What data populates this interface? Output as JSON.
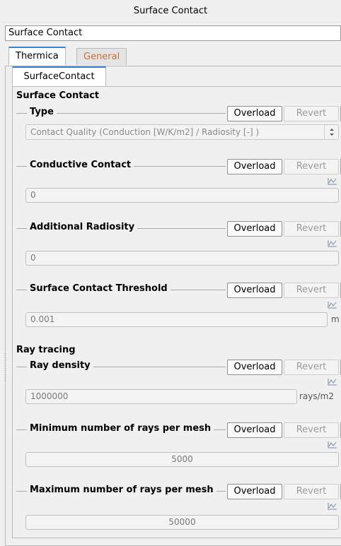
{
  "window": {
    "title": "Surface Contact"
  },
  "name_field": {
    "value": "Surface Contact"
  },
  "tabs": [
    {
      "label": "Thermica"
    },
    {
      "label": "General"
    }
  ],
  "subtab": {
    "label": "SurfaceContact"
  },
  "sections": {
    "surface_contact": "Surface Contact",
    "ray_tracing": "Ray tracing"
  },
  "buttons": {
    "overload": "Overload",
    "revert": "Revert"
  },
  "groups": {
    "type": {
      "label": "Type",
      "value": "Contact Quality (Conduction [W/K/m2] / Radiosity [-]   )"
    },
    "conductive_contact": {
      "label": "Conductive Contact",
      "value": "0"
    },
    "additional_radiosity": {
      "label": "Additional Radiosity",
      "value": "0"
    },
    "threshold": {
      "label": "Surface Contact Threshold",
      "value": "0.001",
      "unit": "m"
    },
    "ray_density": {
      "label": "Ray density",
      "value": "1000000",
      "unit": "rays/m2"
    },
    "min_rays": {
      "label": "Minimum number of rays per mesh",
      "value": "5000"
    },
    "max_rays": {
      "label": "Maximum number of rays per mesh",
      "value": "50000"
    }
  },
  "icons": {
    "trend": "trend-chart-icon",
    "combo_arrow": "up-down-arrow-icon"
  }
}
